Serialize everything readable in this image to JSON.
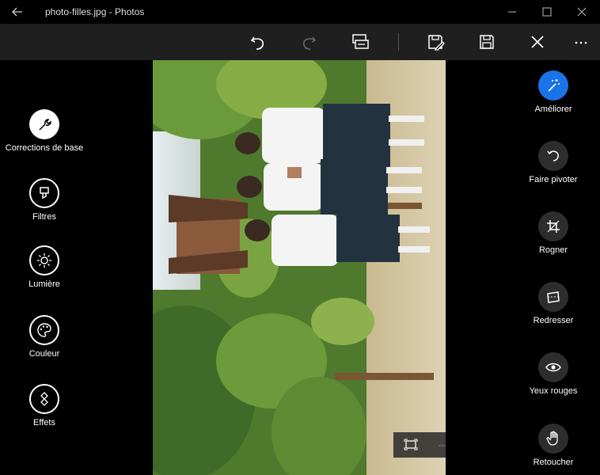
{
  "window": {
    "title": "photo-filles.jpg - Photos"
  },
  "toolbar": {
    "undo_icon": "undo-icon",
    "redo_icon": "redo-icon",
    "compare_icon": "compare-icon",
    "save_copy_icon": "save-copy-icon",
    "save_icon": "save-icon",
    "close_icon": "close-icon",
    "more_icon": "more-icon"
  },
  "left_tools": [
    {
      "label": "Corrections de base",
      "icon": "wrench-icon"
    },
    {
      "label": "Filtres",
      "icon": "filter-icon"
    },
    {
      "label": "Lumière",
      "icon": "light-icon"
    },
    {
      "label": "Couleur",
      "icon": "palette-icon"
    },
    {
      "label": "Effets",
      "icon": "effects-icon"
    }
  ],
  "right_tools": [
    {
      "label": "Améliorer",
      "icon": "magic-wand-icon"
    },
    {
      "label": "Faire pivoter",
      "icon": "rotate-icon"
    },
    {
      "label": "Rogner",
      "icon": "crop-icon"
    },
    {
      "label": "Redresser",
      "icon": "straighten-icon"
    },
    {
      "label": "Yeux rouges",
      "icon": "eye-icon"
    },
    {
      "label": "Retoucher",
      "icon": "hand-icon"
    }
  ],
  "zoom": {
    "fit_icon": "fit-to-screen-icon",
    "zoom_out_icon": "zoom-out-icon",
    "zoom_in_icon": "zoom-in-icon"
  },
  "colors": {
    "accent": "#1a73e8",
    "background": "#000000",
    "toolbar": "#1f1f1f"
  }
}
